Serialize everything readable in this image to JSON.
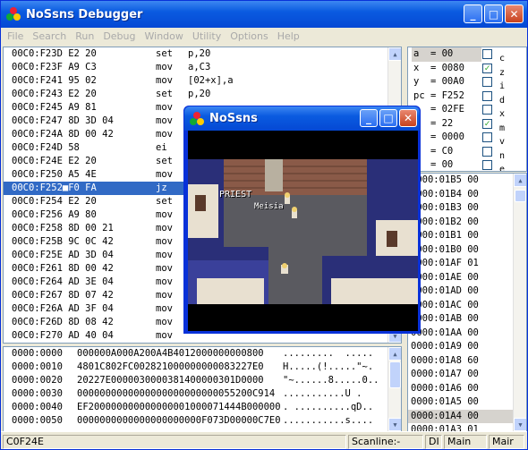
{
  "window": {
    "title": "NoSsns Debugger",
    "min": "_",
    "max": "□",
    "close": "✕"
  },
  "menu": [
    "File",
    "Search",
    "Run",
    "Debug",
    "Window",
    "Utility",
    "Options",
    "Help"
  ],
  "disasm": [
    {
      "addr": "00C0:F23D E2 20",
      "op": "set",
      "arg": "p,20"
    },
    {
      "addr": "00C0:F23F A9 C3",
      "op": "mov",
      "arg": "a,C3"
    },
    {
      "addr": "00C0:F241 95 02",
      "op": "mov",
      "arg": "[02+x],a"
    },
    {
      "addr": "00C0:F243 E2 20",
      "op": "set",
      "arg": "p,20"
    },
    {
      "addr": "00C0:F245 A9 81",
      "op": "mov",
      "arg": ""
    },
    {
      "addr": "00C0:F247 8D 3D 04",
      "op": "mov",
      "arg": ""
    },
    {
      "addr": "00C0:F24A 8D 00 42",
      "op": "mov",
      "arg": ""
    },
    {
      "addr": "00C0:F24D 58",
      "op": "ei",
      "arg": ""
    },
    {
      "addr": "00C0:F24E E2 20",
      "op": "set",
      "arg": ""
    },
    {
      "addr": "00C0:F250 A5 4E",
      "op": "mov",
      "arg": ""
    },
    {
      "addr": "00C0:F252■F0 FA",
      "op": "jz",
      "arg": ""
    },
    {
      "addr": "00C0:F254 E2 20",
      "op": "set",
      "arg": ""
    },
    {
      "addr": "00C0:F256 A9 80",
      "op": "mov",
      "arg": ""
    },
    {
      "addr": "00C0:F258 8D 00 21",
      "op": "mov",
      "arg": ""
    },
    {
      "addr": "00C0:F25B 9C 0C 42",
      "op": "mov",
      "arg": ""
    },
    {
      "addr": "00C0:F25E AD 3D 04",
      "op": "mov",
      "arg": ""
    },
    {
      "addr": "00C0:F261 8D 00 42",
      "op": "mov",
      "arg": ""
    },
    {
      "addr": "00C0:F264 AD 3E 04",
      "op": "mov",
      "arg": ""
    },
    {
      "addr": "00C0:F267 8D 07 42",
      "op": "mov",
      "arg": ""
    },
    {
      "addr": "00C0:F26A AD 3F 04",
      "op": "mov",
      "arg": ""
    },
    {
      "addr": "00C0:F26D 8D 08 42",
      "op": "mov",
      "arg": ""
    },
    {
      "addr": "00C0:F270 AD 40 04",
      "op": "mov",
      "arg": ""
    }
  ],
  "disasm_selected": 10,
  "hex": [
    {
      "addr": "0000:0000",
      "bytes": "000000A000A200A4B4012000000000800",
      "ascii": ".........  ....."
    },
    {
      "addr": "0000:0010",
      "bytes": "4801C802FC002821000000000083227E0",
      "ascii": "H.....(!.....\"~."
    },
    {
      "addr": "0000:0020",
      "bytes": "20227E0000030000381400000301D0000",
      "ascii": "\"~......8.....0.."
    },
    {
      "addr": "0000:0030",
      "bytes": "0000000000000000000000000055200C914",
      "ascii": "...........U ."
    },
    {
      "addr": "0000:0040",
      "bytes": "EF200000000000000001000071444B000000",
      "ascii": ". ..........qD.."
    },
    {
      "addr": "0000:0050",
      "bytes": "0000000000000000000000F073D00000C7E0",
      "ascii": "...........s...."
    }
  ],
  "regs": [
    {
      "text": "a  = 00",
      "flag": "c",
      "checked": false
    },
    {
      "text": "x  = 0080",
      "flag": "z",
      "checked": true
    },
    {
      "text": "y  = 00A0",
      "flag": "i",
      "checked": false
    },
    {
      "text": "pc = F252",
      "flag": "d",
      "checked": false
    },
    {
      "text": "   = 02FE",
      "flag": "x",
      "checked": false
    },
    {
      "text": "   = 22",
      "flag": "m",
      "checked": true
    },
    {
      "text": "   = 0000",
      "flag": "v",
      "checked": false
    },
    {
      "text": "b  = C0",
      "flag": "n",
      "checked": false
    },
    {
      "text": "b  = 00",
      "flag": "e",
      "checked": false
    }
  ],
  "stack": [
    {
      "addr": "0000:01B5",
      "val": "00"
    },
    {
      "addr": "0000:01B4",
      "val": "00"
    },
    {
      "addr": "0000:01B3",
      "val": "00"
    },
    {
      "addr": "0000:01B2",
      "val": "00"
    },
    {
      "addr": "0000:01B1",
      "val": "00"
    },
    {
      "addr": "0000:01B0",
      "val": "00"
    },
    {
      "addr": "0000:01AF",
      "val": "01"
    },
    {
      "addr": "0000:01AE",
      "val": "00"
    },
    {
      "addr": "0000:01AD",
      "val": "00"
    },
    {
      "addr": "0000:01AC",
      "val": "00"
    },
    {
      "addr": "0000:01AB",
      "val": "00"
    },
    {
      "addr": "0000:01AA",
      "val": "00"
    },
    {
      "addr": "0000:01A9",
      "val": "00"
    },
    {
      "addr": "0000:01A8",
      "val": "60"
    },
    {
      "addr": "0000:01A7",
      "val": "00"
    },
    {
      "addr": "0000:01A6",
      "val": "00"
    },
    {
      "addr": "0000:01A5",
      "val": "00"
    },
    {
      "addr": "0000:01A4",
      "val": "00"
    },
    {
      "addr": "0000:01A3",
      "val": "01"
    }
  ],
  "stack_selected": 17,
  "status": {
    "pc": "C0F24E",
    "scan": "Scanline:-",
    "di": "DI",
    "main1": "Main",
    "main2": "Mair"
  },
  "popup": {
    "title": "NoSsns",
    "label1": "PRIEST",
    "label2": "Meisia"
  }
}
